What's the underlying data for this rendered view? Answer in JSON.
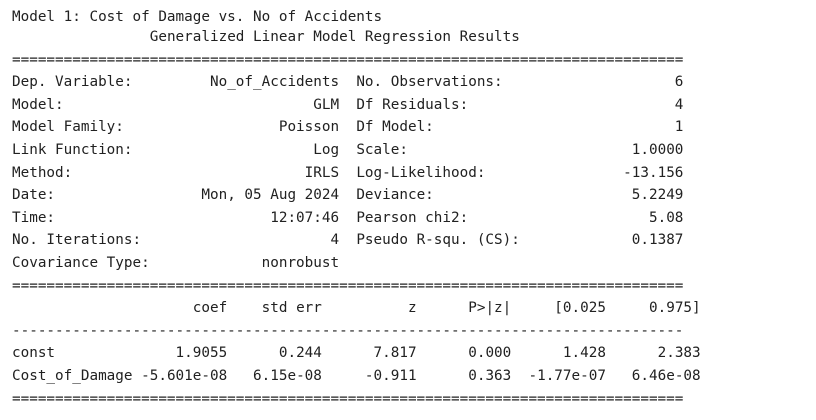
{
  "model_label": "Model 1: Cost of Damage vs. No of Accidents",
  "summary_title": "Generalized Linear Model Regression Results",
  "separators": {
    "double": "==============================================================================",
    "single": "------------------------------------------------------------------------------"
  },
  "info_rows": [
    {
      "left_label": "Dep. Variable:",
      "left_value": "No_of_Accidents",
      "right_label": "No. Observations:",
      "right_value": "6"
    },
    {
      "left_label": "Model:",
      "left_value": "GLM",
      "right_label": "Df Residuals:",
      "right_value": "4"
    },
    {
      "left_label": "Model Family:",
      "left_value": "Poisson",
      "right_label": "Df Model:",
      "right_value": "1"
    },
    {
      "left_label": "Link Function:",
      "left_value": "Log",
      "right_label": "Scale:",
      "right_value": "1.0000"
    },
    {
      "left_label": "Method:",
      "left_value": "IRLS",
      "right_label": "Log-Likelihood:",
      "right_value": "-13.156"
    },
    {
      "left_label": "Date:",
      "left_value": "Mon, 05 Aug 2024",
      "right_label": "Deviance:",
      "right_value": "5.2249"
    },
    {
      "left_label": "Time:",
      "left_value": "12:07:46",
      "right_label": "Pearson chi2:",
      "right_value": "5.08"
    },
    {
      "left_label": "No. Iterations:",
      "left_value": "4",
      "right_label": "Pseudo R-squ. (CS):",
      "right_value": "0.1387"
    },
    {
      "left_label": "Covariance Type:",
      "left_value": "nonrobust",
      "right_label": "",
      "right_value": ""
    }
  ],
  "coef_table": {
    "headers": [
      "",
      "coef",
      "std err",
      "z",
      "P>|z|",
      "[0.025",
      "0.975]"
    ],
    "rows": [
      [
        "const",
        "1.9055",
        "0.244",
        "7.817",
        "0.000",
        "1.428",
        "2.383"
      ],
      [
        "Cost_of_Damage",
        "-5.601e-08",
        "6.15e-08",
        "-0.911",
        "0.363",
        "-1.77e-07",
        "6.46e-08"
      ]
    ]
  }
}
